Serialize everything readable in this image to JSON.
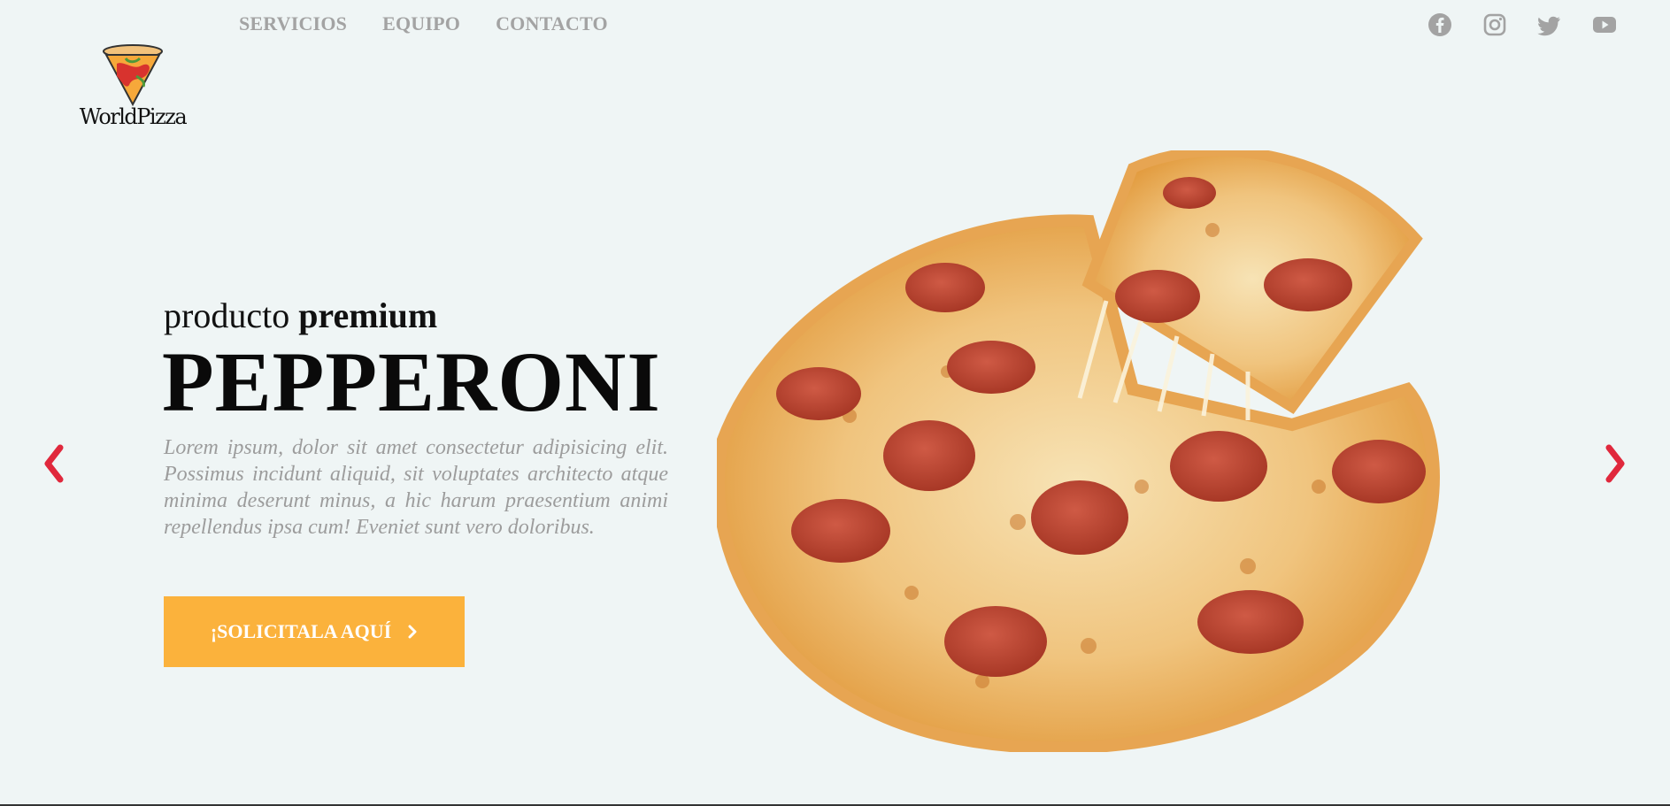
{
  "nav": {
    "items": [
      "SERVICIOS",
      "EQUIPO",
      "CONTACTO"
    ]
  },
  "logo": {
    "text": "WorldPizza"
  },
  "social": {
    "icons": [
      "facebook-icon",
      "instagram-icon",
      "twitter-icon",
      "youtube-icon"
    ],
    "color": "#a3a3a3"
  },
  "hero": {
    "subtitle_light": "producto",
    "subtitle_bold": "premium",
    "title": "PEPPERONI",
    "description": "Lorem ipsum, dolor sit amet consectetur adipisicing elit. Possimus incidunt aliquid, sit voluptates architecto atque minima deserunt minus, a hic harum praesentium animi repellendus ipsa cum! Eveniet sunt vero doloribus.",
    "cta_label": "¡SOLICITALA AQUÍ"
  },
  "colors": {
    "background": "#eff5f5",
    "accent": "#fbb23c",
    "arrow": "#e0283c",
    "nav_text": "#a3a3a3"
  }
}
